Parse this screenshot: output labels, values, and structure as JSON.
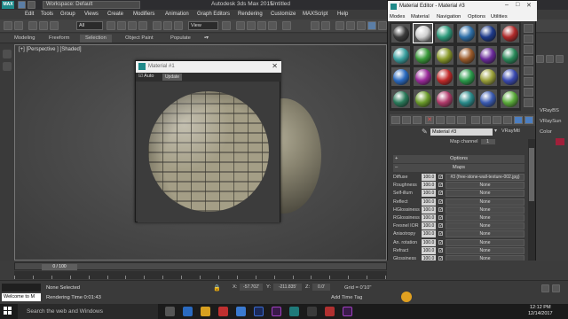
{
  "titlebar": {
    "logo": "MAX",
    "workspace": "Workspace: Default",
    "app_title": "Autodesk 3ds Max  2015",
    "doc_title": "Untitled"
  },
  "menubar": [
    "Edit",
    "Tools",
    "Group",
    "Views",
    "Create",
    "Modifiers",
    "Animation",
    "Graph Editors",
    "Rendering",
    "Customize",
    "MAXScript",
    "Help"
  ],
  "toolbar": {
    "selection_filter": "All",
    "view_dropdown": "View"
  },
  "ribbon": [
    "Modeling",
    "Freeform",
    "Selection",
    "Object Paint",
    "Populate"
  ],
  "viewport": {
    "label": "[+] [Perspective ] [Shaded]"
  },
  "material_window": {
    "title": "Material #1",
    "auto_label": "Auto",
    "update_label": "Update"
  },
  "material_editor": {
    "title": "Material Editor - Material #3",
    "menu": [
      "Modes",
      "Material",
      "Navigation",
      "Options",
      "Utilities"
    ],
    "slot_colors": [
      "#3a3a3a",
      "#d0d0d0",
      "#2e9b7c",
      "#2e6fa8",
      "#1e3a8a",
      "#b02a2a",
      "#3aa0a0",
      "#3a9a3a",
      "#8a9a2a",
      "#9a5a2a",
      "#6a2a9a",
      "#2a8a5a",
      "#2a6ac0",
      "#9a2a9a",
      "#c02a2a",
      "#2a9a4a",
      "#9aa03a",
      "#3a4ab0",
      "#2a7a5a",
      "#6a9a2a",
      "#b03a6a",
      "#2a8a8a",
      "#3a5ab0",
      "#5aaa3a"
    ],
    "material_name": "Material #3",
    "material_type": "VRayMtl",
    "map_channel_label": "Map channel",
    "map_channel_value": "1",
    "rollouts": {
      "options": "Options",
      "maps": "Maps"
    },
    "maps": [
      {
        "name": "Diffuse",
        "value": "100.0",
        "map": "#3 (free-stone-wall-texture-002.jpg)"
      },
      {
        "name": "Roughness",
        "value": "100.0",
        "map": "None"
      },
      {
        "name": "Self-illum",
        "value": "100.0",
        "map": "None"
      },
      {
        "name": "Reflect",
        "value": "100.0",
        "map": "None"
      },
      {
        "name": "HGlossiness",
        "value": "100.0",
        "map": "None"
      },
      {
        "name": "RGlossiness",
        "value": "100.0",
        "map": "None"
      },
      {
        "name": "Fresnel IOR",
        "value": "100.0",
        "map": "None"
      },
      {
        "name": "Anisotropy",
        "value": "100.0",
        "map": "None"
      },
      {
        "name": "An. rotation",
        "value": "100.0",
        "map": "None"
      },
      {
        "name": "Refract",
        "value": "100.0",
        "map": "None"
      },
      {
        "name": "Glossiness",
        "value": "100.0",
        "map": "None"
      },
      {
        "name": "IOR",
        "value": "100.0",
        "map": "None"
      },
      {
        "name": "Translucent",
        "value": "100.0",
        "map": "None"
      },
      {
        "name": "Fog color",
        "value": "100.0",
        "map": "None"
      },
      {
        "name": "Bump",
        "value": "40.0",
        "map": "#4 (free-stone-wall-texture-002.jpg)"
      },
      {
        "name": "Displace",
        "value": "100.0",
        "map": "None"
      }
    ]
  },
  "right_panel": {
    "vray_bs": "VRayBS",
    "vray_sun": "VRaySun",
    "color": "Color"
  },
  "timeline": {
    "frame": "0 / 100"
  },
  "status": {
    "welcome": "Welcome to M",
    "selected": "None Selected",
    "render_time": "Rendering Time  0:01:43",
    "x": "-57.702'",
    "y": "-211.835'",
    "z": "0.0'",
    "grid": "Grid = 0'10\"",
    "add_time_tag": "Add Time Tag"
  },
  "taskbar": {
    "search": "Search the web and Windows",
    "time": "12:12 PM",
    "date": "12/14/2017"
  }
}
